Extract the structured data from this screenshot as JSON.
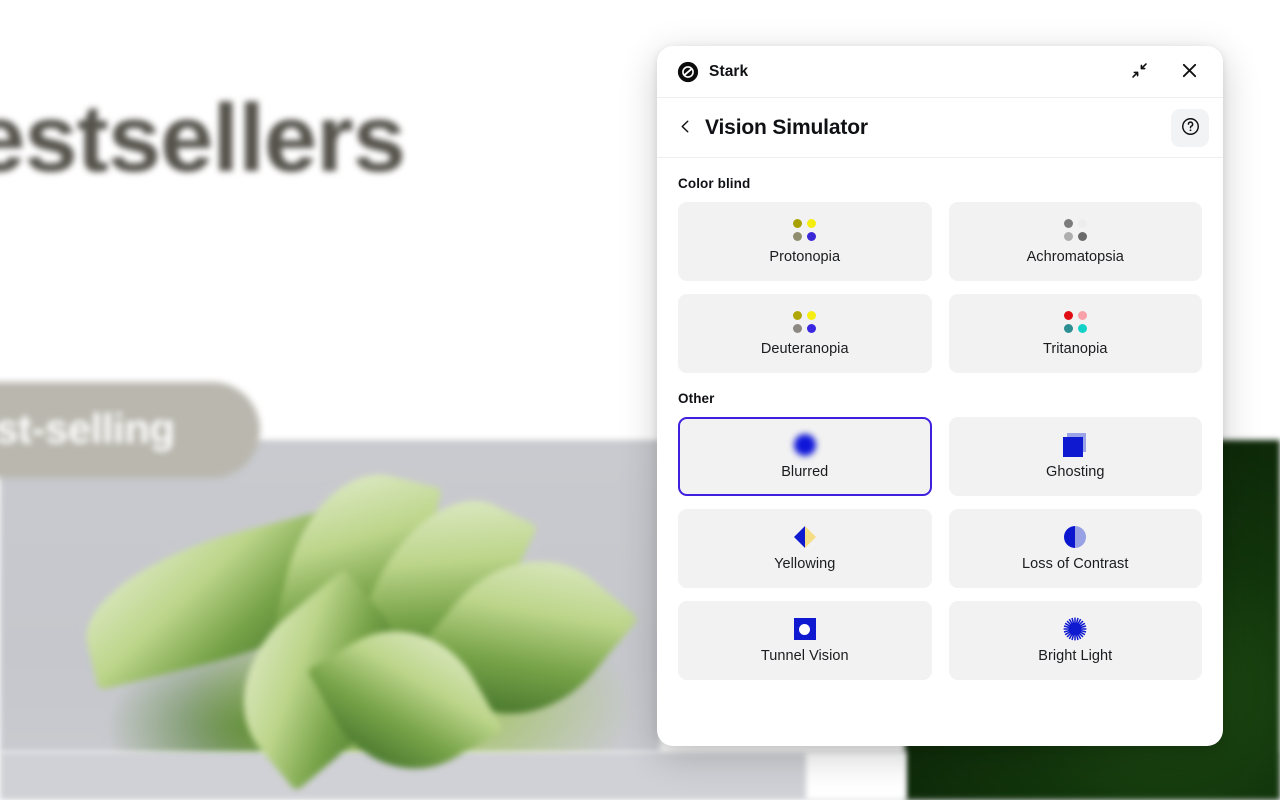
{
  "background": {
    "heading": "estsellers",
    "badge": "ost-selling",
    "photo_alt": "plant-photo"
  },
  "panel": {
    "titlebar": {
      "brand": "Stark",
      "logo_icon": "stark-logo-icon",
      "collapse_icon": "collapse-arrows-icon",
      "close_icon": "close-icon"
    },
    "subheader": {
      "back_icon": "chevron-left-icon",
      "title": "Vision Simulator",
      "help_icon": "question-circle-icon"
    },
    "sections": [
      {
        "title": "Color blind",
        "options": [
          {
            "label": "Protonopia",
            "icon": "four-dots-icon",
            "selected": false,
            "dots": [
              "#a8a104",
              "#f5ed10",
              "#8f8d6e",
              "#3a28d6"
            ]
          },
          {
            "label": "Achromatopsia",
            "icon": "four-dots-icon",
            "selected": false,
            "dots": [
              "#7c7c7c",
              "#ededed",
              "#aeaeae",
              "#6a6a6a"
            ]
          },
          {
            "label": "Deuteranopia",
            "icon": "four-dots-icon",
            "selected": false,
            "dots": [
              "#b0a705",
              "#f6ee12",
              "#8e8882",
              "#3a28e0"
            ]
          },
          {
            "label": "Tritanopia",
            "icon": "four-dots-icon",
            "selected": false,
            "dots": [
              "#e00d12",
              "#f9a0a8",
              "#2d8f92",
              "#13d2c8"
            ]
          }
        ]
      },
      {
        "title": "Other",
        "options": [
          {
            "label": "Blurred",
            "icon": "blurred-circle-icon",
            "selected": true
          },
          {
            "label": "Ghosting",
            "icon": "ghosting-squares-icon",
            "selected": false
          },
          {
            "label": "Yellowing",
            "icon": "yellowing-diamond-icon",
            "selected": false
          },
          {
            "label": "Loss of Contrast",
            "icon": "half-tone-circle-icon",
            "selected": false
          },
          {
            "label": "Tunnel Vision",
            "icon": "tunnel-vision-icon",
            "selected": false
          },
          {
            "label": "Bright Light",
            "icon": "bright-light-icon",
            "selected": false
          }
        ]
      }
    ]
  },
  "colors": {
    "accent_selected_border": "#3f1fe0",
    "icon_blue": "#0f1ad0",
    "card_bg": "#f2f2f2",
    "panel_bg": "#ffffff",
    "text_primary": "#101114"
  }
}
